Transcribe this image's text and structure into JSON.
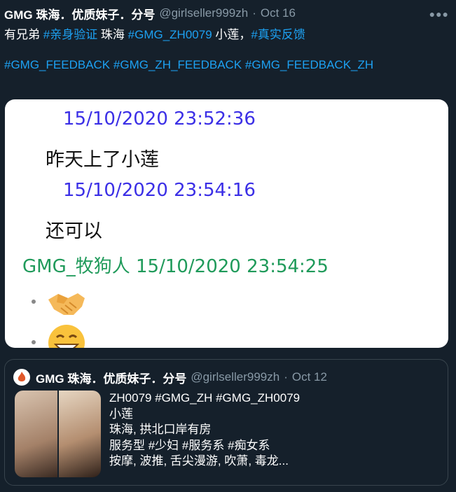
{
  "tweet": {
    "display_name": "GMG 珠海．优质妹子．分号",
    "handle": "@girlseller999zh",
    "separator": "·",
    "date": "Oct 16",
    "more_icon": "more-horizontal-icon",
    "text_line1": {
      "p1": "有兄弟 ",
      "tag1": "#亲身验证",
      "p2": " 珠海 ",
      "tag2": "#GMG_ZH0079",
      "p3": " 小莲，",
      "tag3": "#真实反馈"
    },
    "text_line2": {
      "tag1": "#GMG_FEEDBACK",
      "tag2": "#GMG_ZH_FEEDBACK",
      "tag3": "#GMG_FEEDBACK_ZH"
    }
  },
  "media": {
    "messages": [
      {
        "timestamp": "15/10/2020 23:52:36",
        "text": "昨天上了小莲"
      },
      {
        "timestamp": "15/10/2020 23:54:16",
        "text": "还可以"
      }
    ],
    "reply_sender": "GMG_牧狗人 15/10/2020 23:54:25",
    "emojis": [
      "handshake-emoji",
      "grinning-face-emoji"
    ]
  },
  "quote": {
    "display_name": "GMG 珠海．优质妹子．分号",
    "handle": "@girlseller999zh",
    "separator": "·",
    "date": "Oct 12",
    "lines": [
      "ZH0079 #GMG_ZH #GMG_ZH0079",
      "小莲",
      "珠海, 拱北口岸有房",
      "服务型 #少妇 #服务系 #痴女系",
      "按摩, 波推, 舌尖漫游, 吹萧, 毒龙..."
    ]
  },
  "colors": {
    "background": "#15202b",
    "link": "#1da1f2",
    "muted": "#8899a6",
    "border": "#38444d",
    "timestamp": "#3b2fe6",
    "sender": "#1f9a5a"
  }
}
